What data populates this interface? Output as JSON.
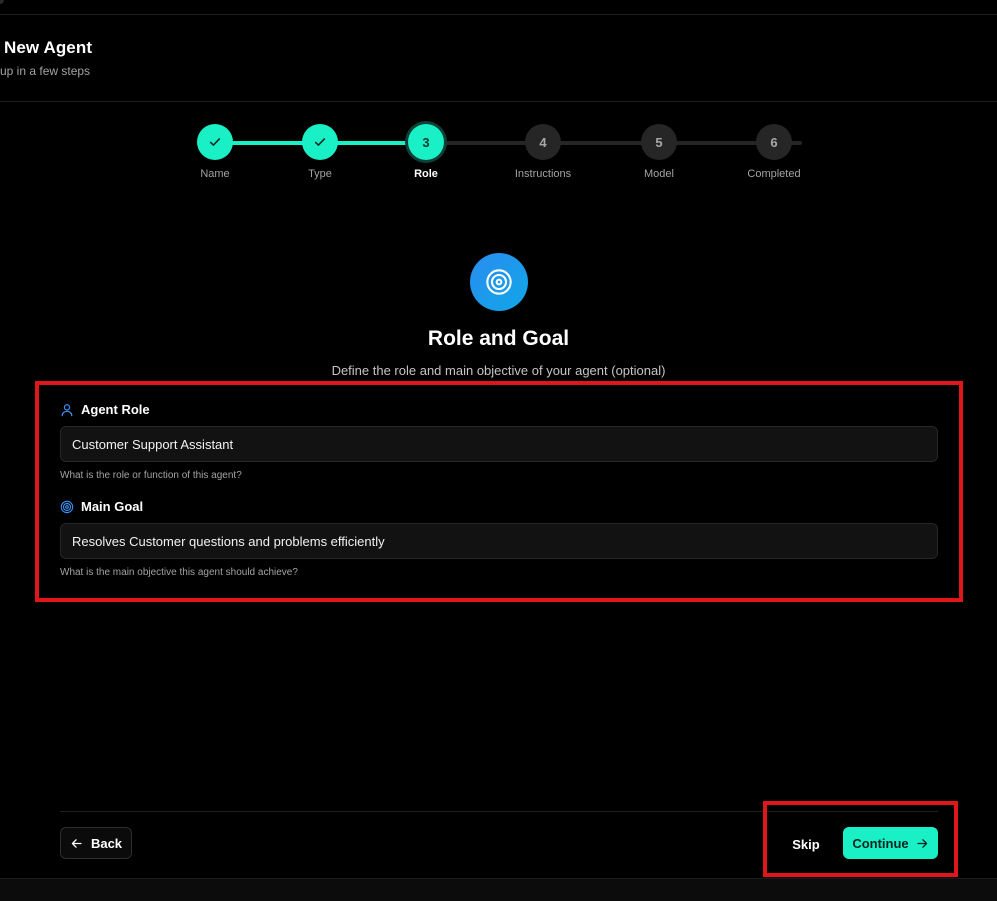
{
  "header": {
    "title": "New Agent",
    "subtitle": "up in a few steps"
  },
  "stepper": {
    "steps": [
      {
        "label": "Name",
        "number": "1",
        "state": "complete"
      },
      {
        "label": "Type",
        "number": "2",
        "state": "complete"
      },
      {
        "label": "Role",
        "number": "3",
        "state": "current"
      },
      {
        "label": "Instructions",
        "number": "4",
        "state": "pending"
      },
      {
        "label": "Model",
        "number": "5",
        "state": "pending"
      },
      {
        "label": "Completed",
        "number": "6",
        "state": "pending"
      }
    ]
  },
  "hero": {
    "icon": "target-icon",
    "title": "Role and Goal",
    "description": "Define the role and main objective of your agent (optional)"
  },
  "form": {
    "role": {
      "icon": "user-icon",
      "label": "Agent Role",
      "value": "Customer Support Assistant",
      "help": "What is the role or function of this agent?"
    },
    "goal": {
      "icon": "target-icon",
      "label": "Main Goal",
      "value": "Resolves Customer questions and problems efficiently",
      "help": "What is the main objective this agent should achieve?"
    }
  },
  "footer": {
    "back_label": "Back",
    "skip_label": "Skip",
    "continue_label": "Continue"
  },
  "colors": {
    "accent": "#19f0c6",
    "icon_blue": "#2a8cf0",
    "highlight": "#e0161b",
    "background": "#000000"
  }
}
